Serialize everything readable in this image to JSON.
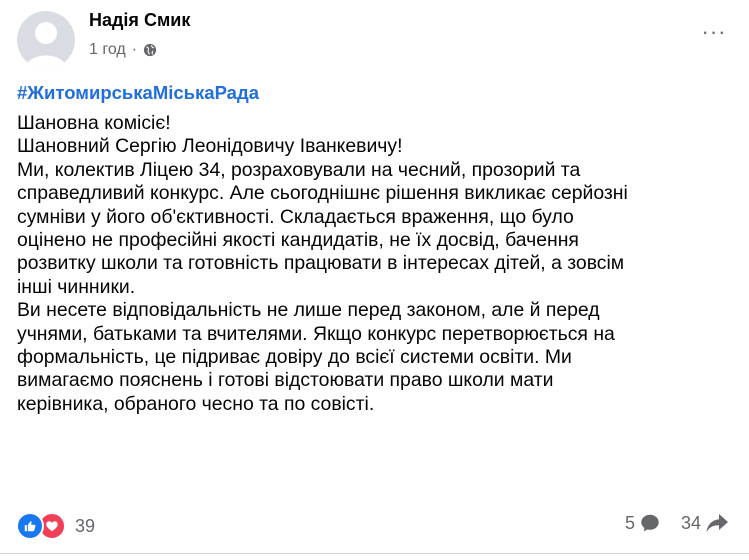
{
  "post": {
    "author": "Надія Смик",
    "time": "1 год",
    "separator": "·",
    "privacy_icon": "globe-icon",
    "more_icon": "more-horizontal-icon",
    "more_label": "···",
    "hashtag": "#ЖитомирськаМіськаРада",
    "lines": [
      "Шановна комісіє!",
      "Шановний Сергію Леонідовичу Іванкевичу!",
      "Ми, колектив Ліцею 34, розраховували на чесний, прозорий та",
      "справедливий конкурс. Але сьогоднішнє рішення викликає серйозні",
      "сумніви у його об'єктивності. Складається враження, що було",
      "оцінено не професійні якості кандидатів, не їх досвід, бачення",
      "розвитку школи та готовність працювати в інтересах дітей, а зовсім",
      "інші чинники.",
      "Ви несете відповідальність не лише перед законом, але й перед",
      "учнями, батьками та вчителями. Якщо конкурс перетворюється на",
      "формальність, це підриває довіру до всієї системи освіти. Ми",
      "вимагаємо пояснень і готові відстоювати право школи мати",
      "керівника, обраного чесно та по совісті."
    ]
  },
  "footer": {
    "reaction_icons": [
      "like-icon",
      "love-icon"
    ],
    "reaction_count": "39",
    "comment_count": "5",
    "share_count": "34"
  },
  "colors": {
    "hashtag": "#216fdb",
    "secondary_text": "#65676b",
    "like": "#1877f2",
    "love": "#f33e58"
  }
}
